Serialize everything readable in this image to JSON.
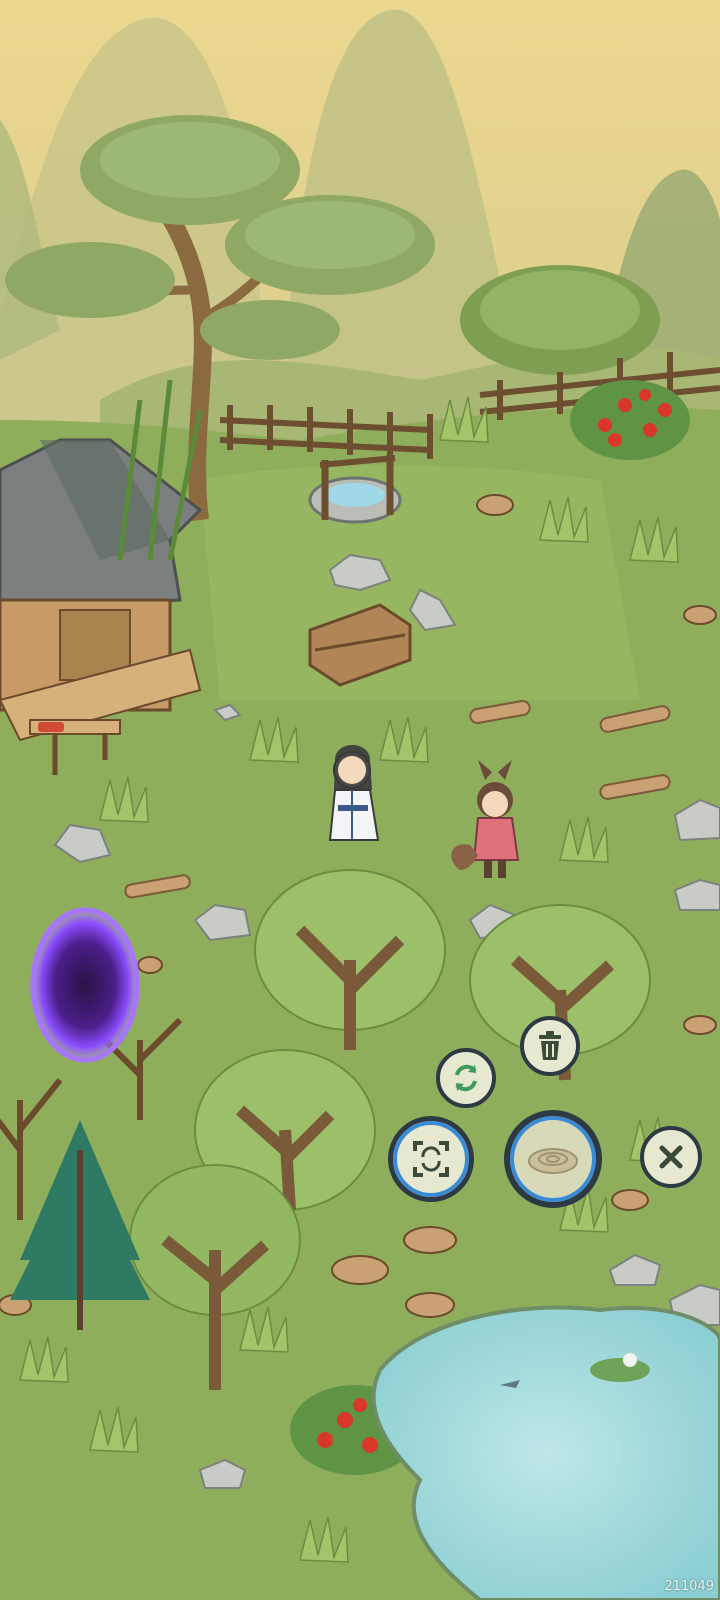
{
  "build_id": "211049",
  "colors": {
    "sky": "#e9d792",
    "mountain": "#cfc58e",
    "grass": "#8fae5c",
    "grass_light": "#a9c46c",
    "grass_dark": "#6f9146",
    "pond": "#a8dde0",
    "portal": "#8a4dff",
    "button_fill": "#e6e9cf",
    "button_ring": "#2d3a44",
    "progress_blue": "#3a8bd6"
  },
  "hud": {
    "rotate_icon": "rotate-icon",
    "delete_icon": "trash-icon",
    "move_icon": "move-icon",
    "confirm_icon": "stump-preview-icon",
    "cancel_icon": "close-icon"
  },
  "characters": [
    {
      "name": "white-robed-cultivator"
    },
    {
      "name": "fox-eared-girl"
    }
  ]
}
